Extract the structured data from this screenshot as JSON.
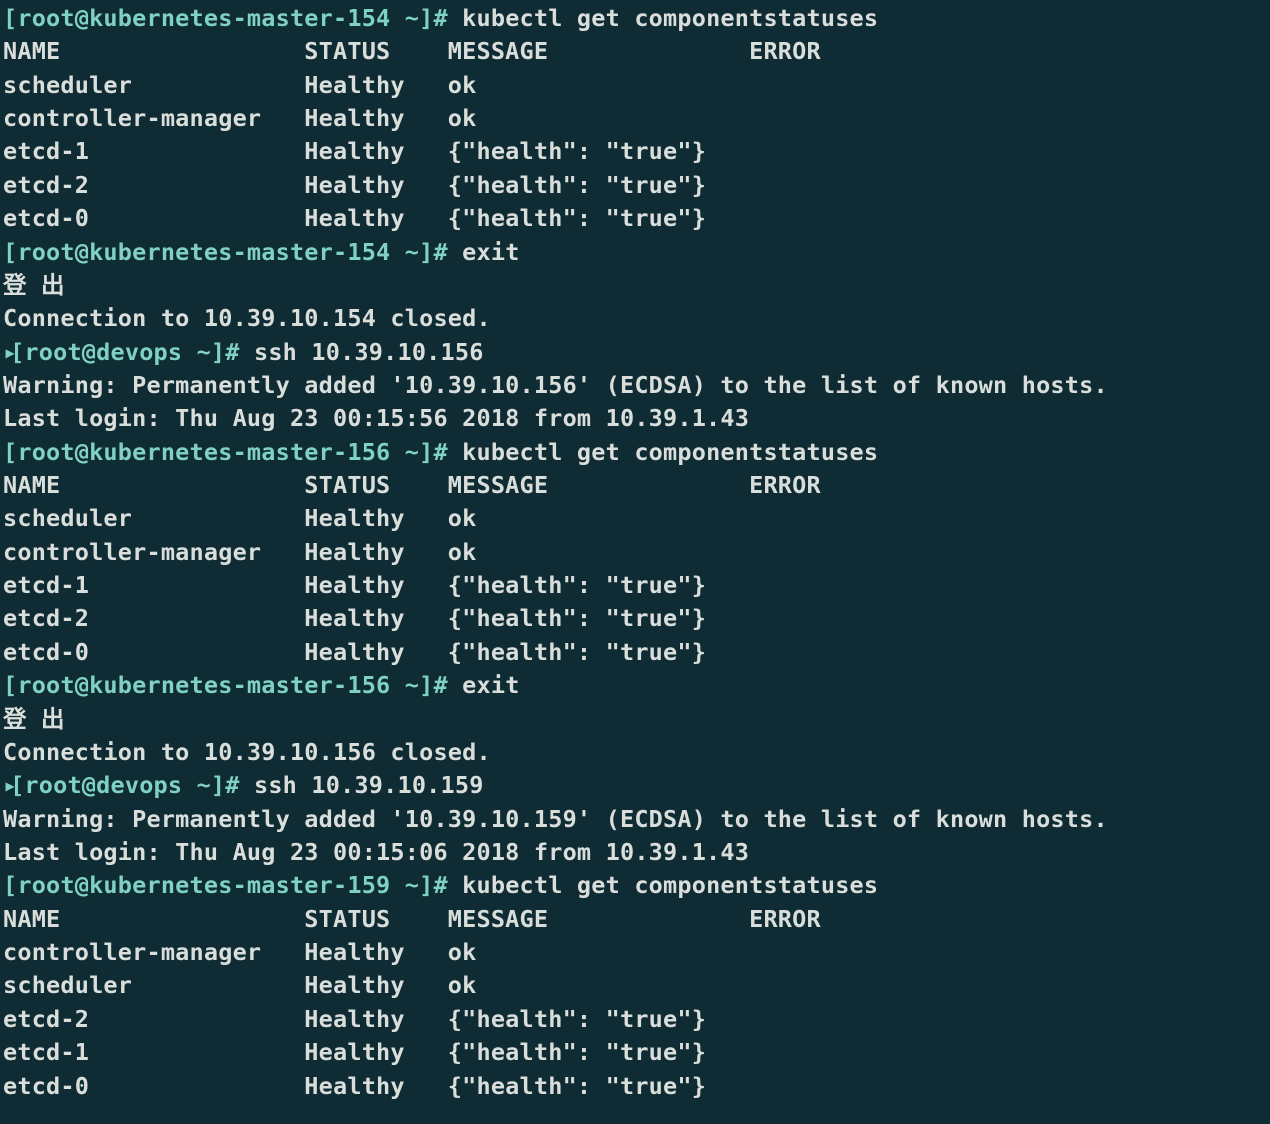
{
  "lines": [
    {
      "segments": [
        {
          "class": "prompt-green",
          "key": "s1.p1"
        },
        {
          "class": "",
          "key": "s1.c1"
        }
      ]
    },
    {
      "segments": [
        {
          "class": "",
          "key": "s1.hdr"
        }
      ]
    },
    {
      "segments": [
        {
          "class": "",
          "key": "s1.r1"
        }
      ]
    },
    {
      "segments": [
        {
          "class": "",
          "key": "s1.r2"
        }
      ]
    },
    {
      "segments": [
        {
          "class": "",
          "key": "s1.r3"
        }
      ]
    },
    {
      "segments": [
        {
          "class": "",
          "key": "s1.r4"
        }
      ]
    },
    {
      "segments": [
        {
          "class": "",
          "key": "s1.r5"
        }
      ]
    },
    {
      "segments": [
        {
          "class": "prompt-green",
          "key": "s1.p2"
        },
        {
          "class": "",
          "key": "s1.c2"
        }
      ]
    },
    {
      "segments": [
        {
          "class": "",
          "key": "s1.logout"
        }
      ]
    },
    {
      "segments": [
        {
          "class": "",
          "key": "s1.closed"
        }
      ]
    },
    {
      "segments": [
        {
          "class": "sel-caret",
          "key": "caret"
        },
        {
          "class": "prompt-green",
          "key": "s2.p1"
        },
        {
          "class": "",
          "key": "s2.c1"
        }
      ]
    },
    {
      "segments": [
        {
          "class": "",
          "key": "s2.warn"
        }
      ]
    },
    {
      "segments": [
        {
          "class": "",
          "key": "s2.last"
        }
      ]
    },
    {
      "segments": [
        {
          "class": "prompt-green",
          "key": "s2.p2"
        },
        {
          "class": "",
          "key": "s2.c2"
        }
      ]
    },
    {
      "segments": [
        {
          "class": "",
          "key": "s2.hdr"
        }
      ]
    },
    {
      "segments": [
        {
          "class": "",
          "key": "s2.r1"
        }
      ]
    },
    {
      "segments": [
        {
          "class": "",
          "key": "s2.r2"
        }
      ]
    },
    {
      "segments": [
        {
          "class": "",
          "key": "s2.r3"
        }
      ]
    },
    {
      "segments": [
        {
          "class": "",
          "key": "s2.r4"
        }
      ]
    },
    {
      "segments": [
        {
          "class": "",
          "key": "s2.r5"
        }
      ]
    },
    {
      "segments": [
        {
          "class": "prompt-green",
          "key": "s2.p3"
        },
        {
          "class": "",
          "key": "s2.c3"
        }
      ]
    },
    {
      "segments": [
        {
          "class": "",
          "key": "s2.logout"
        }
      ]
    },
    {
      "segments": [
        {
          "class": "",
          "key": "s2.closed"
        }
      ]
    },
    {
      "segments": [
        {
          "class": "sel-caret",
          "key": "caret"
        },
        {
          "class": "prompt-green",
          "key": "s3.p1"
        },
        {
          "class": "",
          "key": "s3.c1"
        }
      ]
    },
    {
      "segments": [
        {
          "class": "",
          "key": "s3.warn"
        }
      ]
    },
    {
      "segments": [
        {
          "class": "",
          "key": "s3.last"
        }
      ]
    },
    {
      "segments": [
        {
          "class": "prompt-green",
          "key": "s3.p2"
        },
        {
          "class": "",
          "key": "s3.c2"
        }
      ]
    },
    {
      "segments": [
        {
          "class": "",
          "key": "s3.hdr"
        }
      ]
    },
    {
      "segments": [
        {
          "class": "",
          "key": "s3.r1"
        }
      ]
    },
    {
      "segments": [
        {
          "class": "",
          "key": "s3.r2"
        }
      ]
    },
    {
      "segments": [
        {
          "class": "",
          "key": "s3.r3"
        }
      ]
    },
    {
      "segments": [
        {
          "class": "",
          "key": "s3.r4"
        }
      ]
    },
    {
      "segments": [
        {
          "class": "",
          "key": "s3.r5"
        }
      ]
    }
  ],
  "text": {
    "caret": "▸",
    "s1": {
      "p1": "[root@kubernetes-master-154 ~]#",
      "c1": " kubectl get componentstatuses",
      "hdr": "NAME                 STATUS    MESSAGE              ERROR",
      "r1": "scheduler            Healthy   ok",
      "r2": "controller-manager   Healthy   ok",
      "r3": "etcd-1               Healthy   {\"health\": \"true\"}",
      "r4": "etcd-2               Healthy   {\"health\": \"true\"}",
      "r5": "etcd-0               Healthy   {\"health\": \"true\"}",
      "p2": "[root@kubernetes-master-154 ~]#",
      "c2": " exit",
      "logout": "登 出",
      "closed": "Connection to 10.39.10.154 closed."
    },
    "s2": {
      "p1": "[root@devops ~]#",
      "c1": " ssh 10.39.10.156",
      "warn": "Warning: Permanently added '10.39.10.156' (ECDSA) to the list of known hosts.",
      "last": "Last login: Thu Aug 23 00:15:56 2018 from 10.39.1.43",
      "p2": "[root@kubernetes-master-156 ~]#",
      "c2": " kubectl get componentstatuses",
      "hdr": "NAME                 STATUS    MESSAGE              ERROR",
      "r1": "scheduler            Healthy   ok",
      "r2": "controller-manager   Healthy   ok",
      "r3": "etcd-1               Healthy   {\"health\": \"true\"}",
      "r4": "etcd-2               Healthy   {\"health\": \"true\"}",
      "r5": "etcd-0               Healthy   {\"health\": \"true\"}",
      "p3": "[root@kubernetes-master-156 ~]#",
      "c3": " exit",
      "logout": "登 出",
      "closed": "Connection to 10.39.10.156 closed."
    },
    "s3": {
      "p1": "[root@devops ~]#",
      "c1": " ssh 10.39.10.159",
      "warn": "Warning: Permanently added '10.39.10.159' (ECDSA) to the list of known hosts.",
      "last": "Last login: Thu Aug 23 00:15:06 2018 from 10.39.1.43",
      "p2": "[root@kubernetes-master-159 ~]#",
      "c2": " kubectl get componentstatuses",
      "hdr": "NAME                 STATUS    MESSAGE              ERROR",
      "r1": "controller-manager   Healthy   ok",
      "r2": "scheduler            Healthy   ok",
      "r3": "etcd-2               Healthy   {\"health\": \"true\"}",
      "r4": "etcd-1               Healthy   {\"health\": \"true\"}",
      "r5": "etcd-0               Healthy   {\"health\": \"true\"}"
    }
  }
}
